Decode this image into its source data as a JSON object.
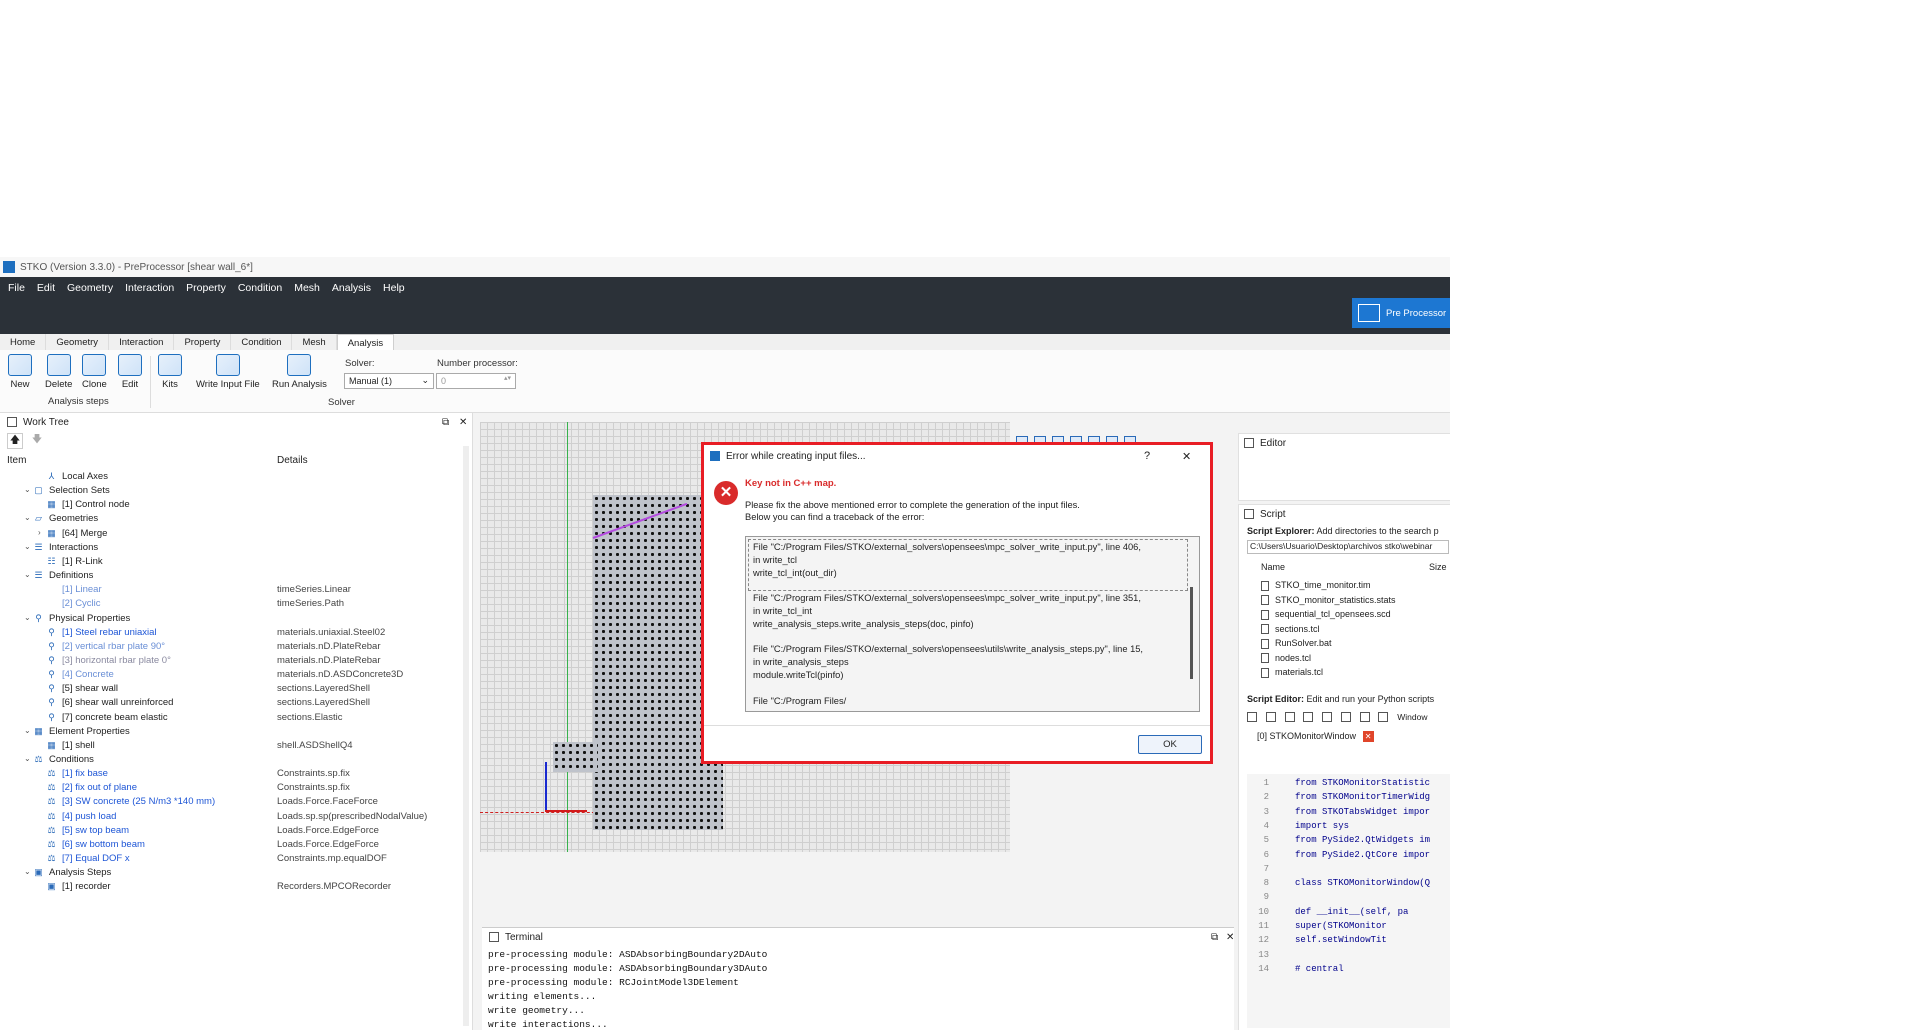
{
  "window": {
    "title": "STKO (Version 3.3.0) - PreProcessor [shear wall_6*]"
  },
  "menu": [
    "File",
    "Edit",
    "Geometry",
    "Interaction",
    "Property",
    "Condition",
    "Mesh",
    "Analysis",
    "Help"
  ],
  "mode_button": "Pre Processor",
  "tabs": [
    "Home",
    "Geometry",
    "Interaction",
    "Property",
    "Condition",
    "Mesh",
    "Analysis"
  ],
  "active_tab": "Analysis",
  "ribbon": {
    "analysis_steps": {
      "new": "New",
      "delete": "Delete",
      "clone": "Clone",
      "edit": "Edit",
      "group": "Analysis steps"
    },
    "kits": "Kits",
    "write_input_file": "Write Input File",
    "run_analysis": "Run Analysis",
    "solver_label": "Solver:",
    "solver_value": "Manual (1)",
    "nproc_label": "Number processor:",
    "nproc_value": "0",
    "group_solver": "Solver"
  },
  "work_tree": {
    "title": "Work Tree",
    "col_item": "Item",
    "col_details": "Details",
    "rows": [
      {
        "label": "Local Axes",
        "details": ""
      },
      {
        "label": "Selection Sets",
        "details": ""
      },
      {
        "label": "[1] Control node",
        "details": ""
      },
      {
        "label": "Geometries",
        "details": ""
      },
      {
        "label": "[64] Merge",
        "details": ""
      },
      {
        "label": "Interactions",
        "details": ""
      },
      {
        "label": "[1] R-Link",
        "details": ""
      },
      {
        "label": "Definitions",
        "details": ""
      },
      {
        "label": "[1] Linear",
        "details": "timeSeries.Linear"
      },
      {
        "label": "[2] Cyclic",
        "details": "timeSeries.Path"
      },
      {
        "label": "Physical Properties",
        "details": ""
      },
      {
        "label": "[1] Steel rebar uniaxial",
        "details": "materials.uniaxial.Steel02"
      },
      {
        "label": "[2] vertical rbar plate 90°",
        "details": "materials.nD.PlateRebar"
      },
      {
        "label": "[3] horizontal rbar plate 0°",
        "details": "materials.nD.PlateRebar"
      },
      {
        "label": "[4] Concrete",
        "details": "materials.nD.ASDConcrete3D"
      },
      {
        "label": "[5] shear wall",
        "details": "sections.LayeredShell"
      },
      {
        "label": "[6] shear wall unreinforced",
        "details": "sections.LayeredShell"
      },
      {
        "label": "[7] concrete beam elastic",
        "details": "sections.Elastic"
      },
      {
        "label": "Element Properties",
        "details": ""
      },
      {
        "label": "[1] shell",
        "details": "shell.ASDShellQ4"
      },
      {
        "label": "Conditions",
        "details": ""
      },
      {
        "label": "[1] fix base",
        "details": "Constraints.sp.fix"
      },
      {
        "label": "[2] fix out of plane",
        "details": "Constraints.sp.fix"
      },
      {
        "label": "[3] SW concrete (25 N/m3 *140 mm)",
        "details": "Loads.Force.FaceForce"
      },
      {
        "label": "[4] push load",
        "details": "Loads.sp.sp(prescribedNodalValue)"
      },
      {
        "label": "[5] sw top  beam",
        "details": "Loads.Force.EdgeForce"
      },
      {
        "label": "[6] sw bottom  beam",
        "details": "Loads.Force.EdgeForce"
      },
      {
        "label": "[7] Equal DOF x",
        "details": "Constraints.mp.equalDOF"
      },
      {
        "label": "Analysis Steps",
        "details": ""
      },
      {
        "label": "[1] recorder",
        "details": "Recorders.MPCORecorder"
      }
    ]
  },
  "terminal": {
    "title": "Terminal",
    "lines": [
      "pre-processing module: ASDAbsorbingBoundary2DAuto",
      "pre-processing module: ASDAbsorbingBoundary3DAuto",
      "pre-processing module: RCJointModel3DElement",
      "writing elements...",
      "write geometry...",
      "write interactions..."
    ]
  },
  "editor": {
    "title": "Editor"
  },
  "script": {
    "title": "Script",
    "explorer_label": "Script Explorer:",
    "explorer_hint": "Add directories to the search p",
    "path": "C:\\Users\\Usuario\\Desktop\\archivos stko\\webinar",
    "col_name": "Name",
    "col_size": "Size",
    "files": [
      "STKO_time_monitor.tim",
      "STKO_monitor_statistics.stats",
      "sequential_tcl_opensees.scd",
      "sections.tcl",
      "RunSolver.bat",
      "nodes.tcl",
      "materials.tcl"
    ],
    "editor_label": "Script Editor:",
    "editor_hint": "Edit and run your Python scripts",
    "window_label": "Window",
    "tab_name": "[0] STKOMonitorWindow",
    "code": [
      {
        "n": "1",
        "t": "from STKOMonitorStatistic"
      },
      {
        "n": "2",
        "t": "from STKOMonitorTimerWidg"
      },
      {
        "n": "3",
        "t": "from STKOTabsWidget impor"
      },
      {
        "n": "4",
        "t": "import sys"
      },
      {
        "n": "5",
        "t": "from PySide2.QtWidgets im"
      },
      {
        "n": "6",
        "t": "from PySide2.QtCore impor"
      },
      {
        "n": "7",
        "t": ""
      },
      {
        "n": "8",
        "t": "class STKOMonitorWindow(Q"
      },
      {
        "n": "9",
        "t": ""
      },
      {
        "n": "10",
        "t": "    def __init__(self, pa"
      },
      {
        "n": "11",
        "t": "        super(STKOMonitor"
      },
      {
        "n": "12",
        "t": "        self.setWindowTit"
      },
      {
        "n": "13",
        "t": ""
      },
      {
        "n": "14",
        "t": "        # central"
      }
    ]
  },
  "dialog": {
    "title": "Error while creating input files...",
    "help": "?",
    "close": "✕",
    "headline": "Key not in C++ map.",
    "message1": "Please fix the above mentioned error to complete the generation of the input files.",
    "message2": "Below you can find a traceback of the error:",
    "traceback": [
      "File \"C:/Program Files/STKO/external_solvers\\opensees\\mpc_solver_write_input.py\", line 406,",
      "in write_tcl",
      "    write_tcl_int(out_dir)",
      "",
      "File \"C:/Program Files/STKO/external_solvers\\opensees\\mpc_solver_write_input.py\", line 351,",
      "in write_tcl_int",
      "    write_analysis_steps.write_analysis_steps(doc, pinfo)",
      "",
      "File \"C:/Program Files/STKO/external_solvers\\opensees\\utils\\write_analysis_steps.py\", line 15,",
      "in write_analysis_steps",
      "    module.writeTcl(pinfo)",
      "",
      "File \"C:/Program Files/"
    ],
    "ok": "OK"
  }
}
